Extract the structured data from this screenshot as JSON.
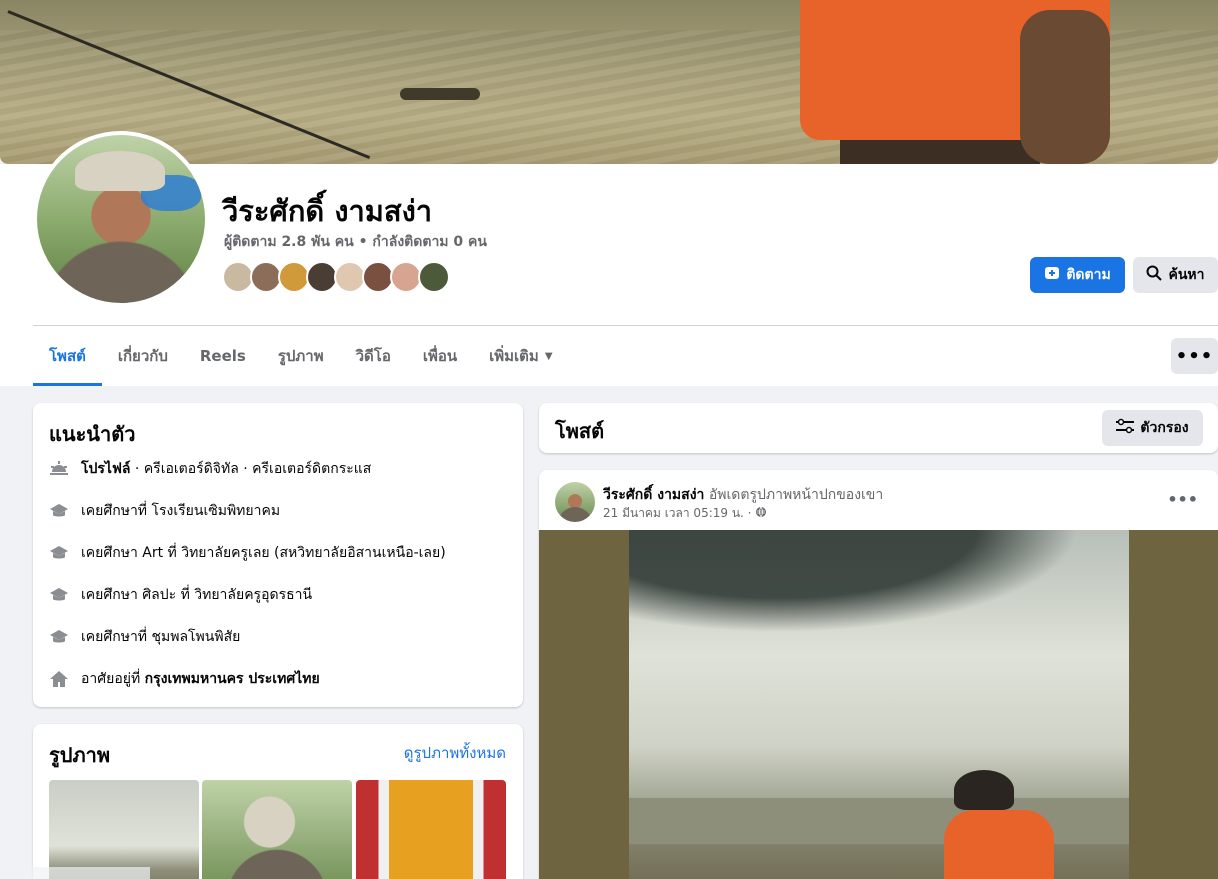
{
  "profile": {
    "name": "วีระศักดิ์ งามสง่า",
    "stats": "ผู้ติดตาม 2.8 พัน คน • กำลังติดตาม 0 คน",
    "follow_label": "ติดตาม",
    "search_label": "ค้นหา"
  },
  "tabs": [
    {
      "label": "โพสต์",
      "active": true
    },
    {
      "label": "เกี่ยวกับ",
      "active": false
    },
    {
      "label": "Reels",
      "active": false
    },
    {
      "label": "รูปภาพ",
      "active": false
    },
    {
      "label": "วิดีโอ",
      "active": false
    },
    {
      "label": "เพื่อน",
      "active": false
    },
    {
      "label": "เพิ่มเติม",
      "active": false
    }
  ],
  "more_button": "•••",
  "intro": {
    "title": "แนะนำตัว",
    "profile_label": "โปรไฟล์",
    "profile_rest": " · ครีเอเตอร์ดิจิทัล · ครีเอเตอร์ดิตกระแส",
    "items": [
      "เคยศึกษาที่ โรงเรียนเซิมพิทยาคม",
      "เคยศึกษา Art ที่ วิทยาลัยครูเลย (สหวิทยาลัยอิสานเหนือ-เลย)",
      "เคยศึกษา ศิลปะ ที่ วิทยาลัยครูอุดรธานี",
      "เคยศึกษาที่ ชุมพลโพนพิสัย"
    ],
    "home_prefix": "อาศัยอยู่ที่ ",
    "home_place": "กรุงเทพมหานคร ประเทศไทย"
  },
  "photos": {
    "title": "รูปภาพ",
    "see_all": "ดูรูปภาพทั้งหมด"
  },
  "posts": {
    "title": "โพสต์",
    "filter_label": "ตัวกรอง"
  },
  "post": {
    "author": "วีระศักดิ์ งามสง่า",
    "action": " อัพเดตรูปภาพหน้าปกของเขา",
    "timestamp": "21 มีนาคม เวลา 05:19 น. ·",
    "dots": "•••"
  },
  "colors": {
    "accent": "#1b74e4",
    "background": "#f0f2f5"
  }
}
